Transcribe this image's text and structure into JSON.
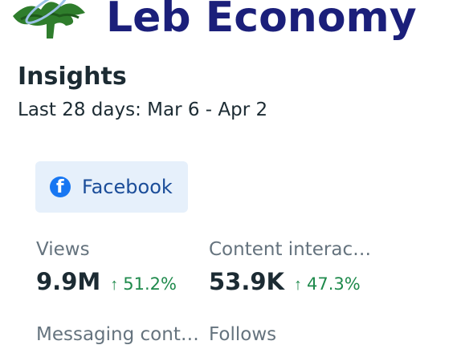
{
  "brand": {
    "title": "Leb Economy",
    "logo_icon": "cedar-tree-logo-icon"
  },
  "insights": {
    "title": "Insights",
    "date_range": "Last 28 days: Mar 6 - Apr 2"
  },
  "platform": {
    "label": "Facebook",
    "icon": "facebook-icon",
    "icon_color": "#1877f2",
    "chip_color": "#e6f0fb"
  },
  "metrics": [
    {
      "label": "Views",
      "value": "9.9M",
      "change": "51.2%"
    },
    {
      "label": "Content interac…",
      "value": "53.9K",
      "change": "47.3%"
    },
    {
      "label": "Messaging cont…",
      "value": "",
      "change": ""
    },
    {
      "label": "Follows",
      "value": "",
      "change": ""
    }
  ],
  "colors": {
    "brand_text": "#1b1f7a",
    "positive_change": "#1f8a4c",
    "primary_text": "#1c2b33",
    "secondary_text": "#65737e"
  }
}
